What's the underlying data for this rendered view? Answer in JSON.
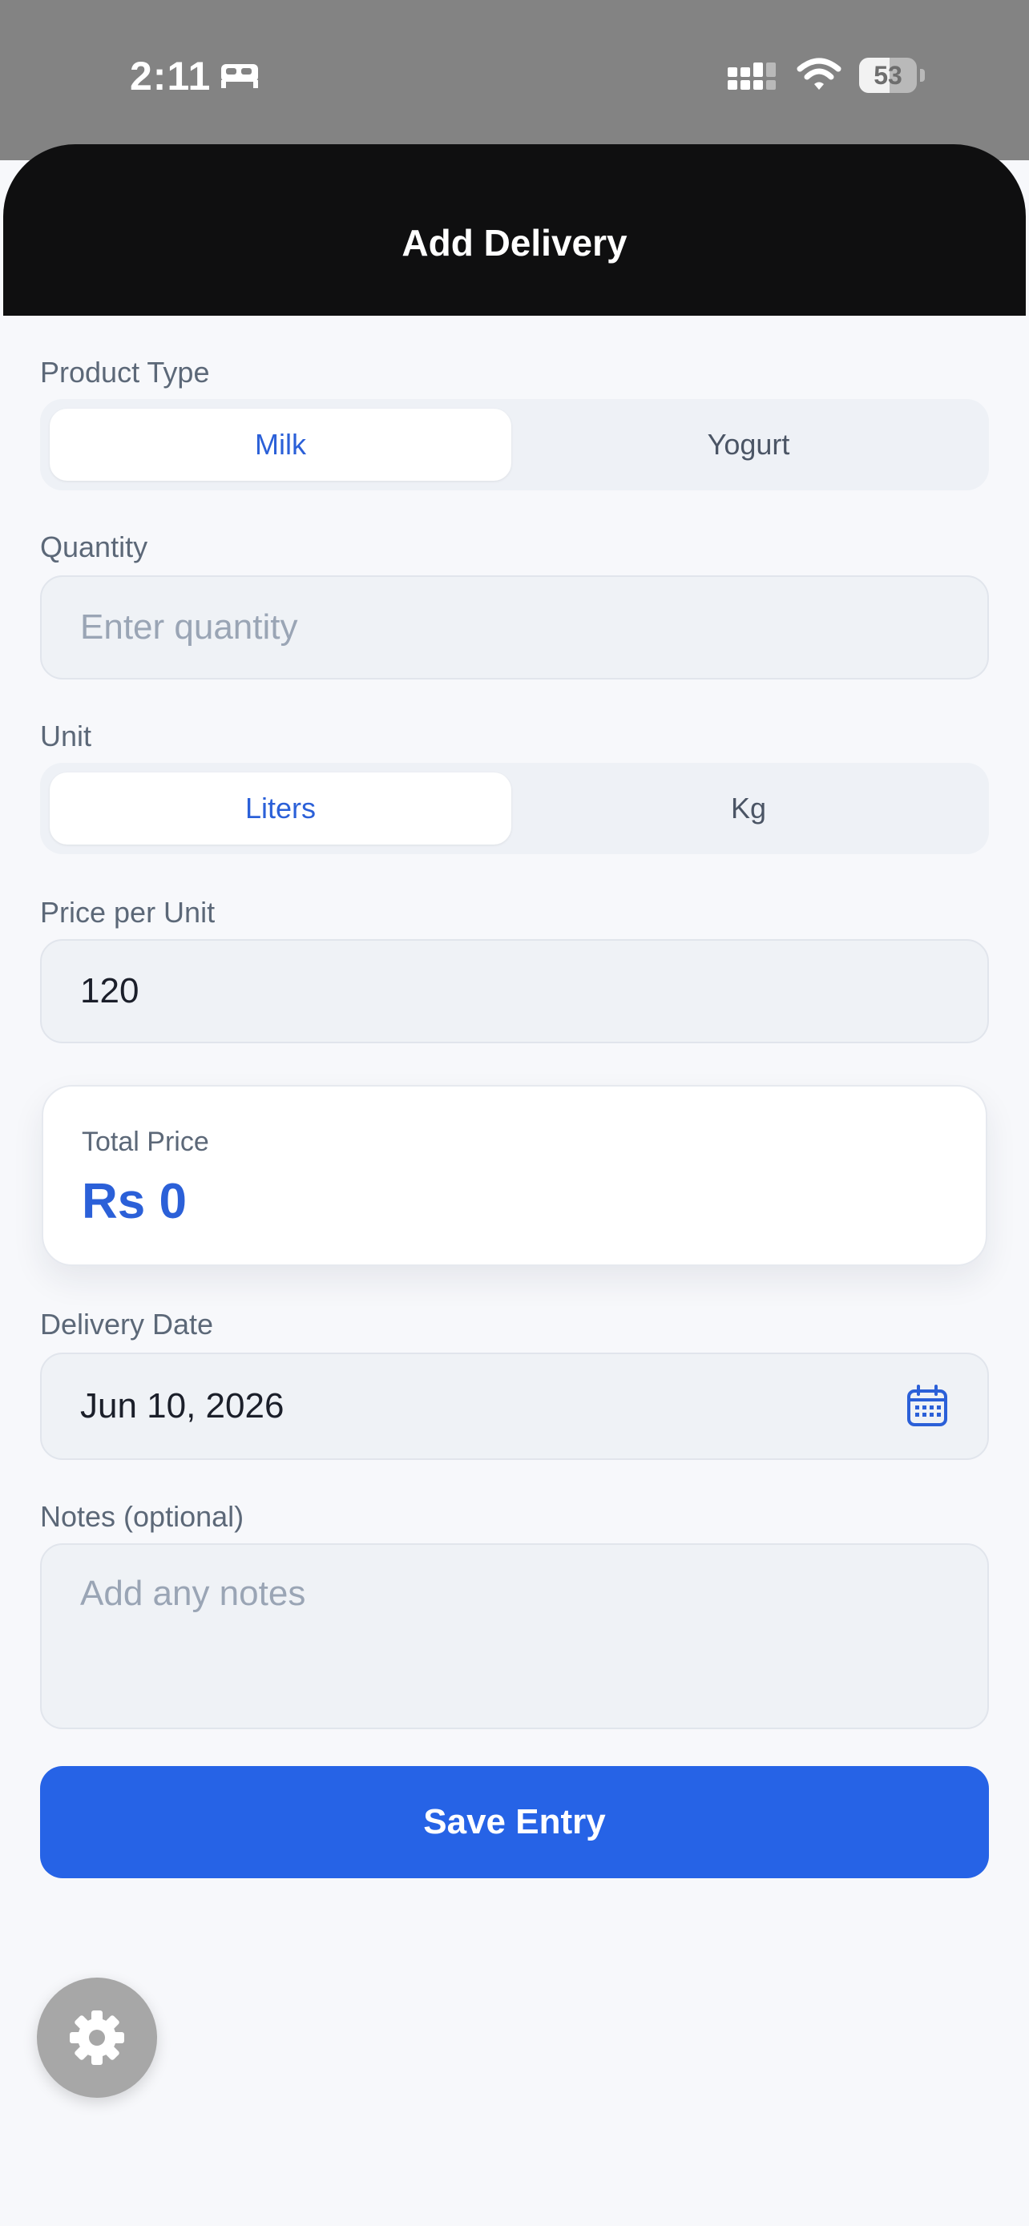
{
  "status_bar": {
    "time": "2:11",
    "battery": "53",
    "battery_level": 0.53
  },
  "header": {
    "title": "Add Delivery"
  },
  "form": {
    "product_type": {
      "label": "Product Type",
      "options": [
        "Milk",
        "Yogurt"
      ],
      "selected": "Milk"
    },
    "quantity": {
      "label": "Quantity",
      "placeholder": "Enter quantity",
      "value": ""
    },
    "unit": {
      "label": "Unit",
      "options": [
        "Liters",
        "Kg"
      ],
      "selected": "Liters"
    },
    "price_per_unit": {
      "label": "Price per Unit",
      "value": "120"
    },
    "total": {
      "label": "Total Price",
      "value": "Rs 0"
    },
    "delivery_date": {
      "label": "Delivery Date",
      "value": "Jun 10, 2026",
      "icon": "calendar-icon"
    },
    "notes": {
      "label": "Notes (optional)",
      "placeholder": "Add any notes"
    },
    "save_label": "Save Entry"
  },
  "settings_button": {
    "icon": "gear-icon"
  },
  "colors": {
    "accent": "#2663e6",
    "header": "#0f0f10",
    "background": "#f7f8fb"
  }
}
